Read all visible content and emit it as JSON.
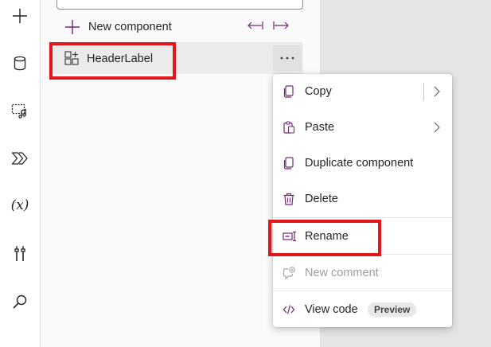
{
  "rail": {
    "items": [
      {
        "icon": "add-icon"
      },
      {
        "icon": "data-icon"
      },
      {
        "icon": "media-icon"
      },
      {
        "icon": "power-automate-icon"
      },
      {
        "icon": "variables-icon",
        "text": "(x)"
      },
      {
        "icon": "advanced-tools-icon"
      },
      {
        "icon": "search-icon"
      }
    ]
  },
  "tree": {
    "new_component_label": "New component",
    "items": [
      {
        "label": "HeaderLabel",
        "icon": "component-icon"
      }
    ]
  },
  "context_menu": {
    "items": [
      {
        "label": "Copy",
        "icon": "copy-icon",
        "has_submenu": true
      },
      {
        "label": "Paste",
        "icon": "paste-icon",
        "has_submenu": true
      },
      {
        "label": "Duplicate component",
        "icon": "duplicate-icon"
      },
      {
        "label": "Delete",
        "icon": "delete-icon"
      },
      {
        "label": "Rename",
        "icon": "rename-icon"
      },
      {
        "label": "New comment",
        "icon": "comment-add-icon",
        "disabled": true
      },
      {
        "label": "View code",
        "icon": "code-icon",
        "badge": "Preview"
      }
    ]
  },
  "colors": {
    "accent": "#742774",
    "highlight": "#e3161c"
  }
}
